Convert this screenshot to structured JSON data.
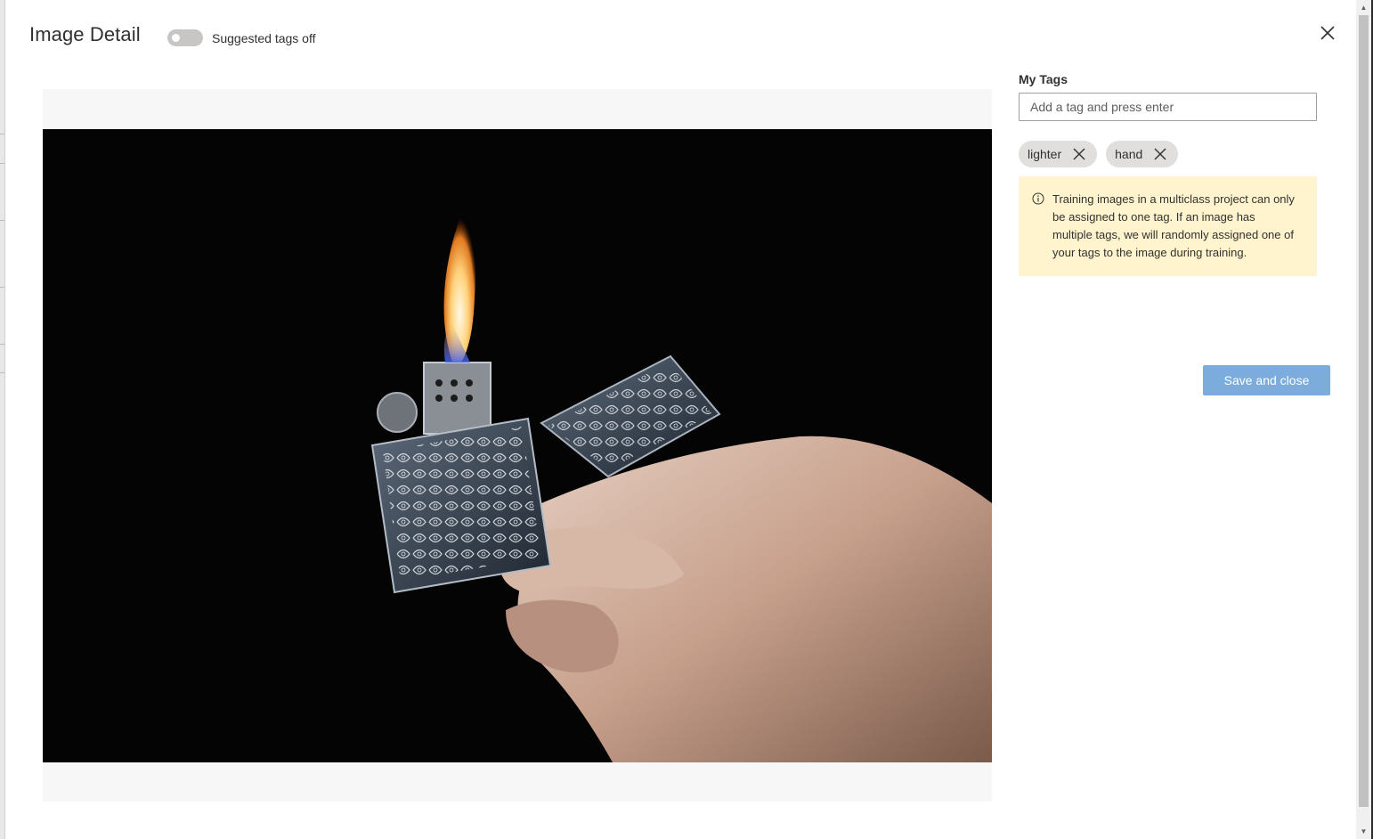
{
  "header": {
    "title": "Image Detail",
    "toggle_label": "Suggested tags off",
    "toggle_on": false
  },
  "tags_panel": {
    "heading": "My Tags",
    "input_placeholder": "Add a tag and press enter",
    "input_value": "",
    "tags": [
      {
        "label": "lighter"
      },
      {
        "label": "hand"
      }
    ],
    "notice": "Training images in a multiclass project can only be assigned to one tag. If an image has multiple tags, we will randomly assigned one of your tags to the image during training.",
    "save_label": "Save and close"
  },
  "image": {
    "description_icon": "photo-lighter-in-hand"
  },
  "colors": {
    "accent_disabled": "#7cacdb",
    "notice_bg": "#fff4ce",
    "chip_bg": "#e1dfdd"
  }
}
